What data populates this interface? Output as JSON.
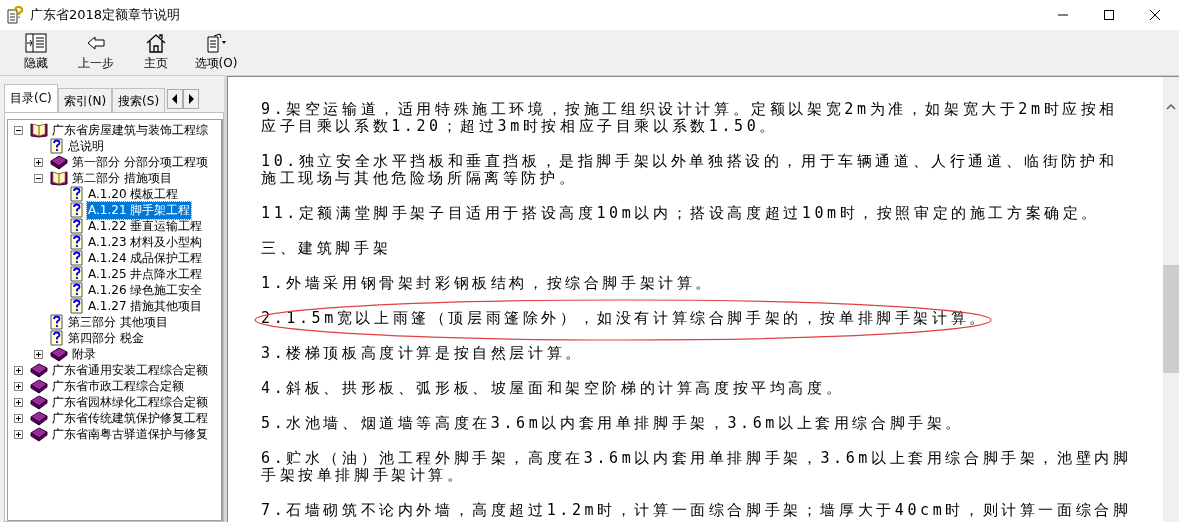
{
  "window": {
    "title": "广东省2018定额章节说明"
  },
  "toolbar": [
    {
      "label": "隐藏",
      "kind": "hide"
    },
    {
      "label": "上一步",
      "kind": "back"
    },
    {
      "label": "主页",
      "kind": "home"
    },
    {
      "label": "选项(O)",
      "kind": "options"
    }
  ],
  "tabs": [
    {
      "label": "目录(C)",
      "selected": true
    },
    {
      "label": "索引(N)",
      "selected": false
    },
    {
      "label": "搜索(S)",
      "selected": false
    }
  ],
  "tree": [
    {
      "label": "广东省房屋建筑与装饰工程综",
      "kind": "book",
      "expanded": true,
      "children": [
        {
          "label": "总说明",
          "kind": "topic",
          "selected": false
        },
        {
          "label": "第一部分 分部分项工程项",
          "kind": "book",
          "expanded": false
        },
        {
          "label": "第二部分 措施项目",
          "kind": "book",
          "expanded": true,
          "children": [
            {
              "label": "A.1.20 模板工程",
              "kind": "topic",
              "selected": false
            },
            {
              "label": "A.1.21 脚手架工程",
              "kind": "topic",
              "selected": true
            },
            {
              "label": "A.1.22 垂直运输工程",
              "kind": "topic",
              "selected": false
            },
            {
              "label": "A.1.23 材料及小型构",
              "kind": "topic",
              "selected": false
            },
            {
              "label": "A.1.24 成品保护工程",
              "kind": "topic",
              "selected": false
            },
            {
              "label": "A.1.25 井点降水工程",
              "kind": "topic",
              "selected": false
            },
            {
              "label": "A.1.26 绿色施工安全",
              "kind": "topic",
              "selected": false
            },
            {
              "label": "A.1.27 措施其他项目",
              "kind": "topic",
              "selected": false
            }
          ]
        },
        {
          "label": "第三部分 其他项目",
          "kind": "topic",
          "selected": false
        },
        {
          "label": "第四部分 税金",
          "kind": "topic",
          "selected": false
        },
        {
          "label": "附录",
          "kind": "book",
          "expanded": false
        }
      ]
    },
    {
      "label": "广东省通用安装工程综合定额",
      "kind": "book",
      "expanded": false
    },
    {
      "label": "广东省市政工程综合定额",
      "kind": "book",
      "expanded": false
    },
    {
      "label": "广东省园林绿化工程综合定额",
      "kind": "book",
      "expanded": false
    },
    {
      "label": "广东省传统建筑保护修复工程",
      "kind": "book",
      "expanded": false
    },
    {
      "label": "广东省南粤古驿道保护与修复",
      "kind": "book",
      "expanded": false
    }
  ],
  "content": [
    {
      "lines": [
        "9.架空运输道，适用特殊施工环境，按施工组织设计计算。定额以架宽2m为准，如架宽大于2m时应按相",
        "应子目乘以系数1.20；超过3m时按相应子目乘以系数1.50。"
      ],
      "circled": false
    },
    {
      "lines": [
        "10.独立安全水平挡板和垂直挡板，是指脚手架以外单独搭设的，用于车辆通道、人行通道、临街防护和",
        "施工现场与其他危险场所隔离等防护。"
      ],
      "circled": false
    },
    {
      "lines": [
        "11.定额满堂脚手架子目适用于搭设高度10m以内；搭设高度超过10m时，按照审定的施工方案确定。"
      ],
      "circled": false
    },
    {
      "lines": [
        "三、建筑脚手架"
      ],
      "circled": false
    },
    {
      "lines": [
        "1.外墙采用钢骨架封彩钢板结构，按综合脚手架计算。"
      ],
      "circled": false
    },
    {
      "lines": [
        "2.1.5m宽以上雨篷（顶层雨篷除外），如没有计算综合脚手架的，按单排脚手架计算。"
      ],
      "circled": true
    },
    {
      "lines": [
        "3.楼梯顶板高度计算是按自然层计算。"
      ],
      "circled": false
    },
    {
      "lines": [
        "4.斜板、拱形板、弧形板、坡屋面和架空阶梯的计算高度按平均高度。"
      ],
      "circled": false
    },
    {
      "lines": [
        "5.水池墙、烟道墙等高度在3.6m以内套用单排脚手架，3.6m以上套用综合脚手架。"
      ],
      "circled": false
    },
    {
      "lines": [
        "6.贮水（油）池工程外脚手架，高度在3.6m以内套用单排脚手架，3.6m以上套用综合脚手架，池壁内脚",
        "手架按单排脚手架计算。"
      ],
      "circled": false
    },
    {
      "lines": [
        "7.石墙砌筑不论内外墙，高度超过1.2m时，计算一面综合脚手架；墙厚大于40cm时，则计算一面综合脚"
      ],
      "circled": false
    }
  ]
}
